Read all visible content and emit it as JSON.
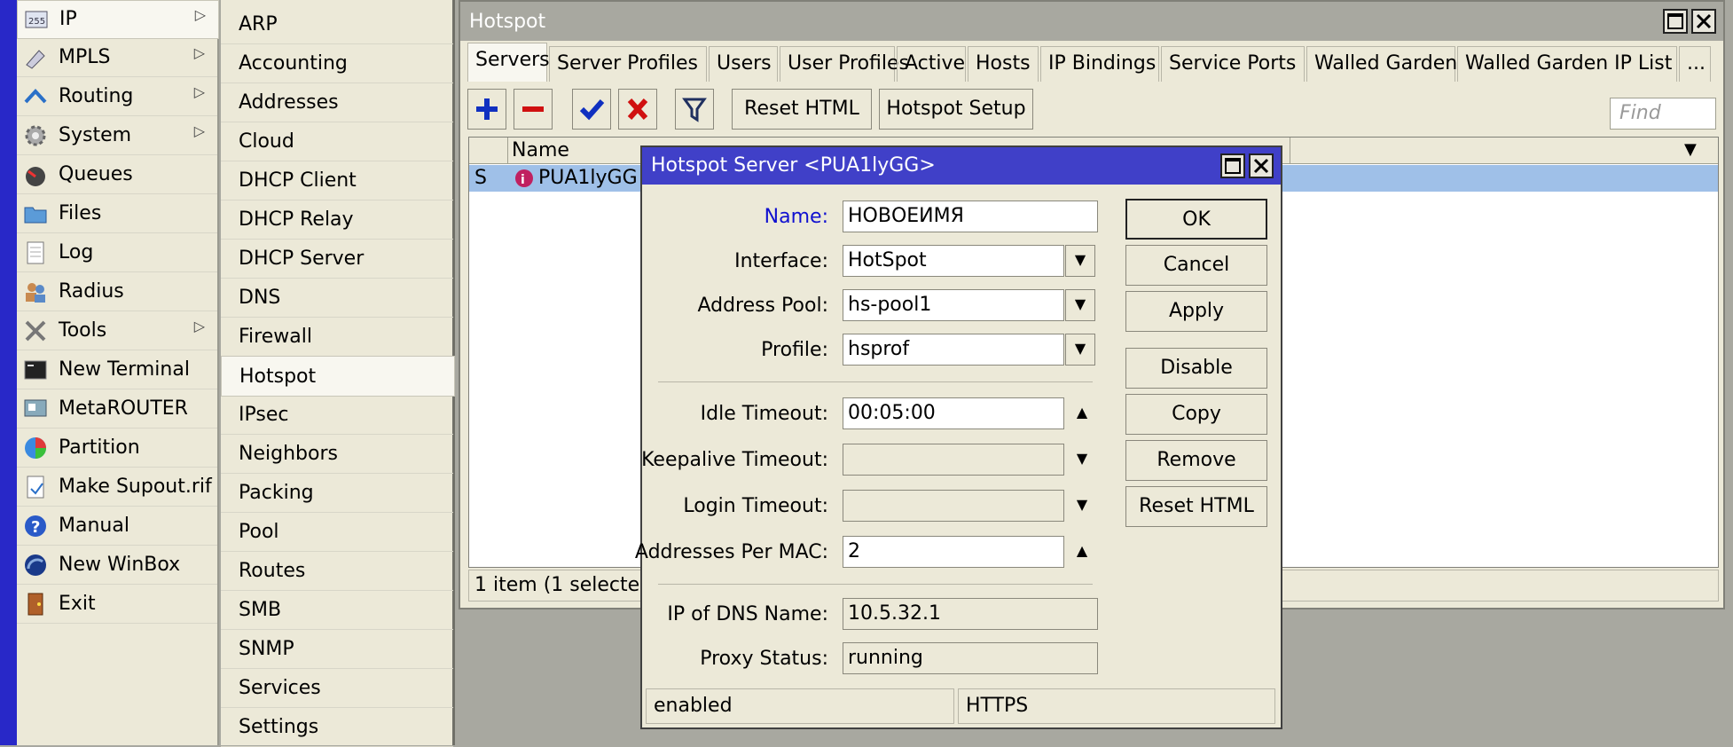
{
  "main_menu": {
    "items": [
      {
        "label": "IP",
        "submenu": true,
        "selected": true,
        "icon": "ip-icon"
      },
      {
        "label": "MPLS",
        "submenu": true,
        "icon": "mpls-icon"
      },
      {
        "label": "Routing",
        "submenu": true,
        "icon": "routing-icon"
      },
      {
        "label": "System",
        "submenu": true,
        "icon": "gear-icon"
      },
      {
        "label": "Queues",
        "submenu": false,
        "icon": "queues-icon"
      },
      {
        "label": "Files",
        "submenu": false,
        "icon": "folder-icon"
      },
      {
        "label": "Log",
        "submenu": false,
        "icon": "log-icon"
      },
      {
        "label": "Radius",
        "submenu": false,
        "icon": "radius-icon"
      },
      {
        "label": "Tools",
        "submenu": true,
        "icon": "tools-icon"
      },
      {
        "label": "New Terminal",
        "submenu": false,
        "icon": "terminal-icon"
      },
      {
        "label": "MetaROUTER",
        "submenu": false,
        "icon": "metarouter-icon"
      },
      {
        "label": "Partition",
        "submenu": false,
        "icon": "partition-icon"
      },
      {
        "label": "Make Supout.rif",
        "submenu": false,
        "icon": "supout-icon"
      },
      {
        "label": "Manual",
        "submenu": false,
        "icon": "help-icon"
      },
      {
        "label": "New WinBox",
        "submenu": false,
        "icon": "winbox-icon"
      },
      {
        "label": "Exit",
        "submenu": false,
        "icon": "exit-icon"
      }
    ]
  },
  "sub_menu": {
    "items": [
      "ARP",
      "Accounting",
      "Addresses",
      "Cloud",
      "DHCP Client",
      "DHCP Relay",
      "DHCP Server",
      "DNS",
      "Firewall",
      "Hotspot",
      "IPsec",
      "Neighbors",
      "Packing",
      "Pool",
      "Routes",
      "SMB",
      "SNMP",
      "Services",
      "Settings"
    ],
    "selected": "Hotspot"
  },
  "hotspot_window": {
    "title": "Hotspot",
    "tabs": [
      "Servers",
      "Server Profiles",
      "Users",
      "User Profiles",
      "Active",
      "Hosts",
      "IP Bindings",
      "Service Ports",
      "Walled Garden",
      "Walled Garden IP List",
      "..."
    ],
    "active_tab": "Servers",
    "toolbar": {
      "reset_html": "Reset HTML",
      "hotspot_setup": "Hotspot Setup",
      "find_placeholder": "Find"
    },
    "table": {
      "columns": [
        "Name"
      ],
      "rows": [
        {
          "flag": "S",
          "name": "PUA1lyGG"
        }
      ]
    },
    "status": "1 item (1 selected)"
  },
  "dialog": {
    "title": "Hotspot Server <PUA1lyGG>",
    "fields": {
      "name": {
        "label": "Name:",
        "value": "НОВОЕИМЯ"
      },
      "interface": {
        "label": "Interface:",
        "value": "HotSpot"
      },
      "address_pool": {
        "label": "Address Pool:",
        "value": "hs-pool1"
      },
      "profile": {
        "label": "Profile:",
        "value": "hsprof"
      },
      "idle_timeout": {
        "label": "Idle Timeout:",
        "value": "00:05:00"
      },
      "keepalive_timeout": {
        "label": "Keepalive Timeout:",
        "value": ""
      },
      "login_timeout": {
        "label": "Login Timeout:",
        "value": ""
      },
      "addresses_per_mac": {
        "label": "Addresses Per MAC:",
        "value": "2"
      },
      "ip_of_dns_name": {
        "label": "IP of DNS Name:",
        "value": "10.5.32.1"
      },
      "proxy_status": {
        "label": "Proxy Status:",
        "value": "running"
      }
    },
    "buttons": {
      "ok": "OK",
      "cancel": "Cancel",
      "apply": "Apply",
      "disable": "Disable",
      "copy": "Copy",
      "remove": "Remove",
      "reset_html": "Reset HTML"
    },
    "status_left": "enabled",
    "status_right": "HTTPS"
  },
  "colors": {
    "title_bar": "#4040c8",
    "selection": "#9fc0e8",
    "name_label": "#1010d0"
  }
}
